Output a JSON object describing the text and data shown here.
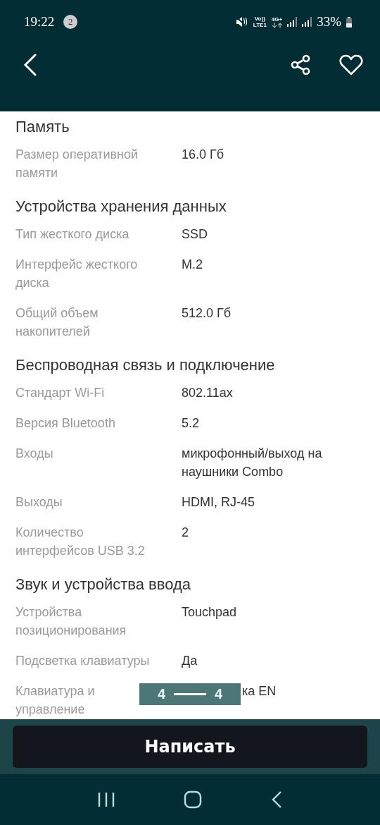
{
  "status_bar": {
    "time": "19:22",
    "notification_count": "2",
    "volte_top": "Vo))",
    "volte_bottom": "LTE1",
    "network": "4G+",
    "battery": "33%"
  },
  "sections": [
    {
      "title": "Память",
      "rows": [
        {
          "label": "Размер оперативной памяти",
          "value": "16.0 Гб"
        }
      ]
    },
    {
      "title": "Устройства хранения данных",
      "rows": [
        {
          "label": "Тип жесткого диска",
          "value": "SSD"
        },
        {
          "label": "Интерфейс жесткого диска",
          "value": "M.2"
        },
        {
          "label": "Общий объем накопителей",
          "value": "512.0 Гб"
        }
      ]
    },
    {
      "title": "Беспроводная связь и подключение",
      "rows": [
        {
          "label": "Стандарт Wi-Fi",
          "value": "802.11ax"
        },
        {
          "label": "Версия Bluetooth",
          "value": "5.2"
        },
        {
          "label": "Входы",
          "value": "микрофонный/выход на наушники Combo"
        },
        {
          "label": "Выходы",
          "value": "HDMI, RJ-45"
        },
        {
          "label": "Количество интерфейсов USB 3.2",
          "value": "2"
        }
      ]
    },
    {
      "title": "Звук и устройства ввода",
      "rows": [
        {
          "label": "Устройства позиционирования",
          "value": "Touchpad"
        },
        {
          "label": "Подсветка клавиатуры",
          "value": "Да"
        },
        {
          "label": "Клавиатура и управление",
          "value": "ка EN",
          "under_page_indicator": true
        }
      ]
    }
  ],
  "page_indicator": {
    "from": "4",
    "to": "4"
  },
  "action_button": "Написать"
}
